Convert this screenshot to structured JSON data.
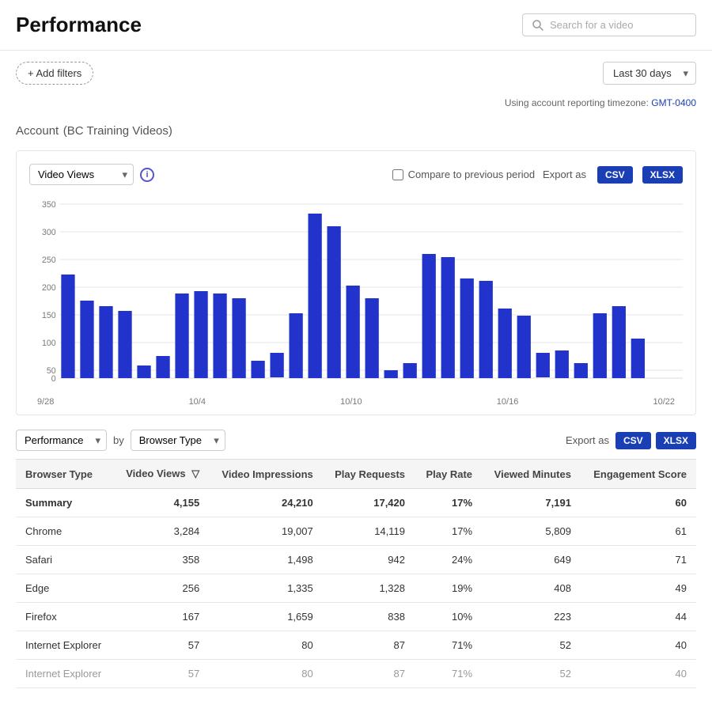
{
  "header": {
    "title": "Performance",
    "search_placeholder": "Search for a video"
  },
  "toolbar": {
    "add_filters_label": "+ Add filters",
    "date_range": "Last 30 days",
    "timezone_text": "Using account reporting timezone:",
    "timezone_link": "GMT-0400"
  },
  "account": {
    "label": "Account",
    "subtitle": "(BC Training Videos)"
  },
  "chart": {
    "metric_label": "Video Views",
    "compare_label": "Compare to previous period",
    "export_label": "Export as",
    "csv_label": "CSV",
    "xlsx_label": "XLSX",
    "x_labels": [
      "9/28",
      "10/4",
      "10/10",
      "10/16",
      "10/22"
    ],
    "y_labels": [
      "350",
      "300",
      "250",
      "200",
      "150",
      "100",
      "50",
      "0"
    ],
    "bars": [
      240,
      155,
      145,
      135,
      25,
      45,
      170,
      175,
      170,
      160,
      35,
      50,
      130,
      330,
      305,
      185,
      160,
      15,
      30,
      250,
      245,
      200,
      195,
      140,
      125,
      50,
      55,
      30,
      130,
      145,
      80
    ],
    "bar_color": "#2233cc"
  },
  "table": {
    "perf_label": "Performance",
    "by_label": "by",
    "browser_label": "Browser Type",
    "export_label": "Export as",
    "csv_label": "CSV",
    "xlsx_label": "XLSX",
    "columns": [
      "Browser Type",
      "Video Views",
      "Video Impressions",
      "Play Requests",
      "Play Rate",
      "Viewed Minutes",
      "Engagement Score"
    ],
    "summary": {
      "label": "Summary",
      "video_views": "4,155",
      "video_impressions": "24,210",
      "play_requests": "17,420",
      "play_rate": "17%",
      "viewed_minutes": "7,191",
      "engagement_score": "60"
    },
    "rows": [
      {
        "browser": "Chrome",
        "video_views": "3,284",
        "video_impressions": "19,007",
        "play_requests": "14,119",
        "play_rate": "17%",
        "viewed_minutes": "5,809",
        "engagement_score": "61"
      },
      {
        "browser": "Safari",
        "video_views": "358",
        "video_impressions": "1,498",
        "play_requests": "942",
        "play_rate": "24%",
        "viewed_minutes": "649",
        "engagement_score": "71"
      },
      {
        "browser": "Edge",
        "video_views": "256",
        "video_impressions": "1,335",
        "play_requests": "1,328",
        "play_rate": "19%",
        "viewed_minutes": "408",
        "engagement_score": "49"
      },
      {
        "browser": "Firefox",
        "video_views": "167",
        "video_impressions": "1,659",
        "play_requests": "838",
        "play_rate": "10%",
        "viewed_minutes": "223",
        "engagement_score": "44"
      },
      {
        "browser": "Internet Explorer",
        "video_views": "57",
        "video_impressions": "80",
        "play_requests": "87",
        "play_rate": "71%",
        "viewed_minutes": "52",
        "engagement_score": "40"
      }
    ]
  }
}
